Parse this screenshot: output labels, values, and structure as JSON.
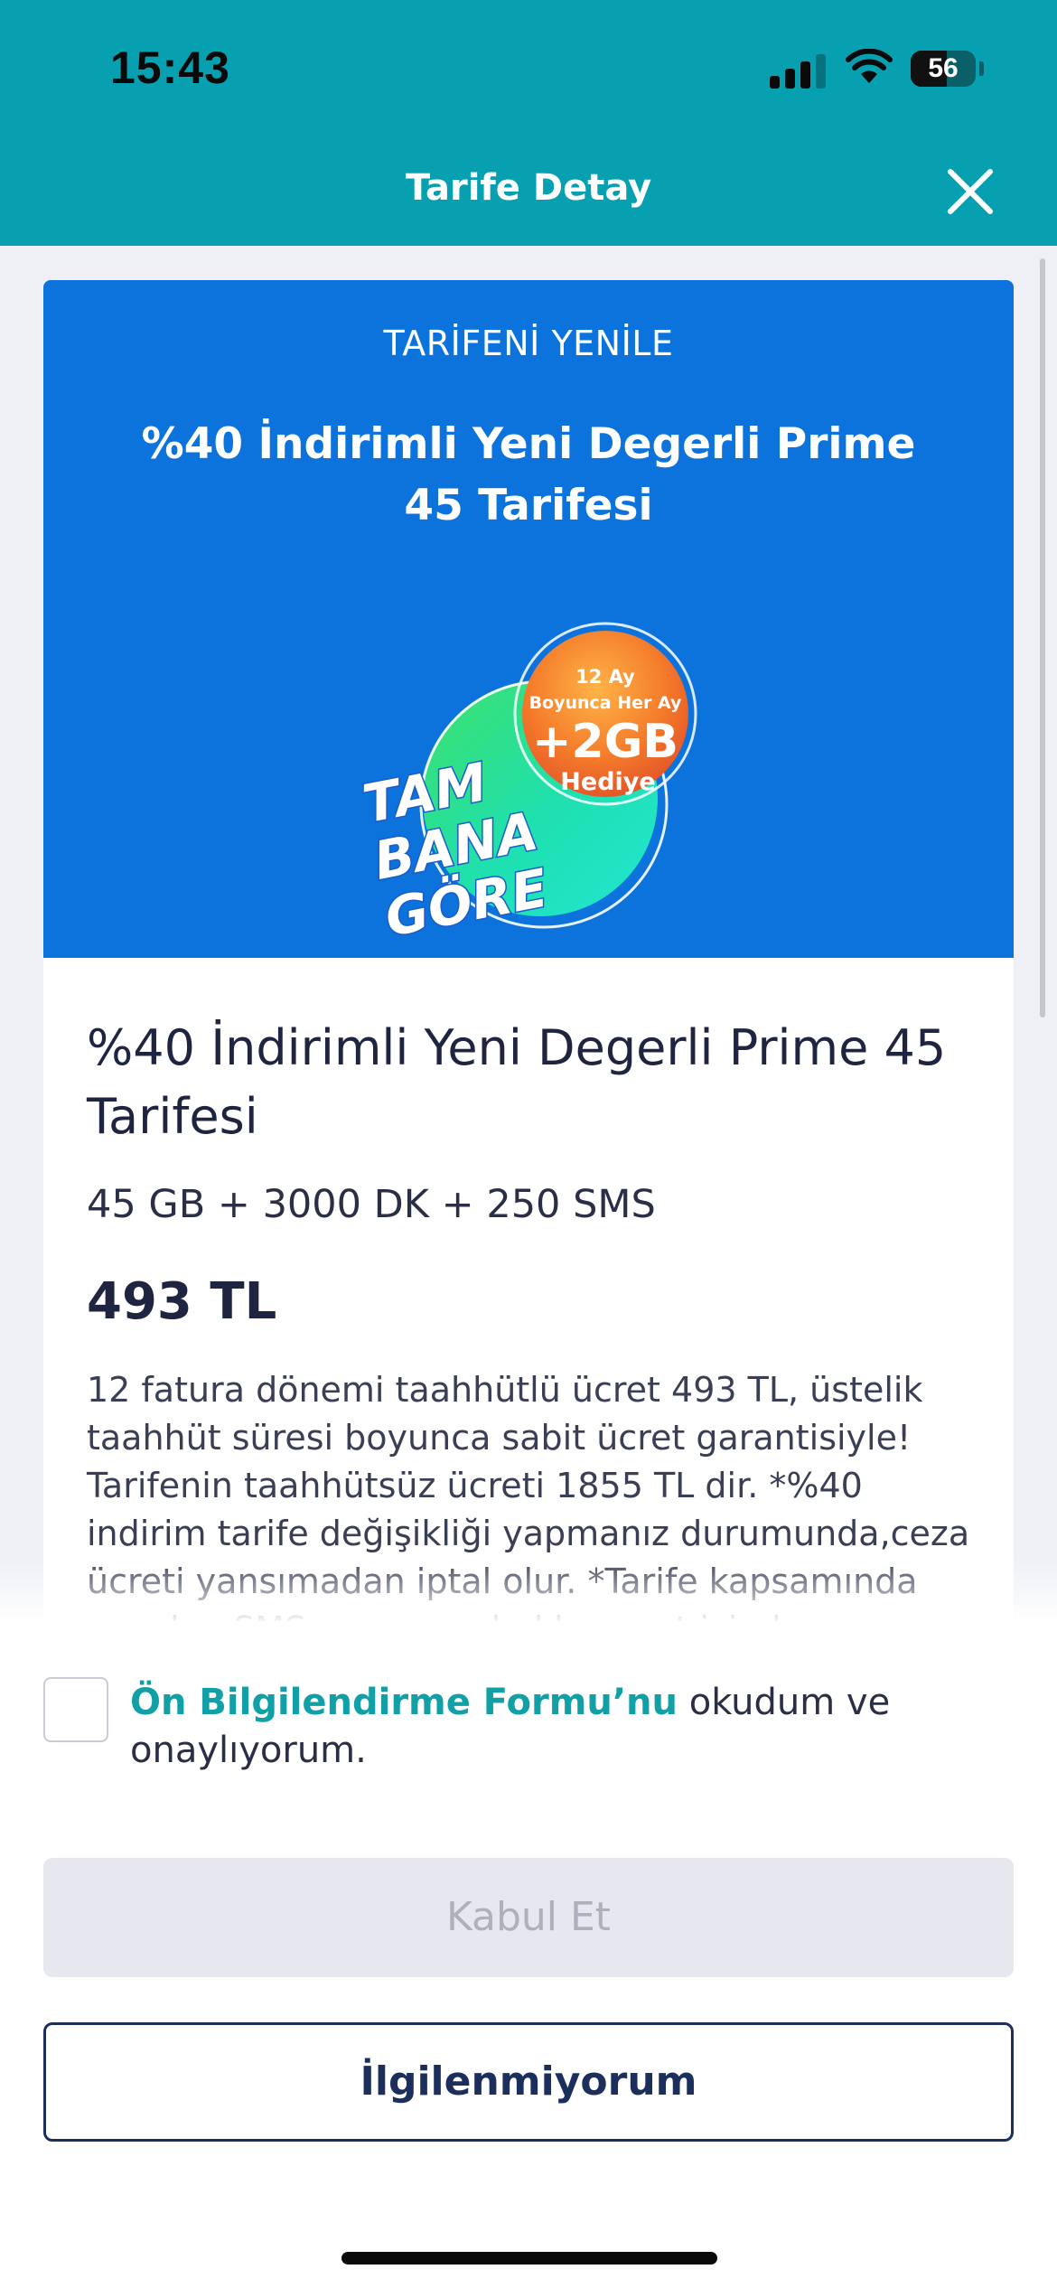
{
  "status_bar": {
    "time": "15:43",
    "battery_percent": "56",
    "battery_level": 0.56,
    "signal_bars_active": 3,
    "signal_bars_total": 4
  },
  "header": {
    "title": "Tarife Detay",
    "close_icon": "close-icon"
  },
  "promo": {
    "overline": "TARİFENİ YENİLE",
    "title": "%40 İndirimli Yeni Degerli Prime 45 Tarifesi",
    "badge": {
      "line1": "12 Ay",
      "line2": "Boyunca Her Ay",
      "line3": "+2GB",
      "line4": "Hediye"
    },
    "brand_lines": [
      "TAM",
      "BANA",
      "GÖRE"
    ]
  },
  "detail": {
    "title": "%40 İndirimli Yeni Degerli Prime 45 Tarifesi",
    "features": "45 GB + 3000 DK + 250 SMS",
    "price": "493 TL",
    "description": "12 fatura dönemi taahhütlü ücret 493 TL, üstelik taahhüt süresi boyunca sabit ücret garantisiyle! Tarifenin taahhütsüz ücreti 1855 TL dir. *%40 indirim tarife değişikliği yapmanız durumunda,ceza ücreti yansımadan iptal olur. *Tarife kapsamında sunulan SMS ve arama hakları yurt içinde geçerlidir."
  },
  "consent": {
    "link_text": "Ön Bilgilendirme Formu’nu",
    "rest_text": " okudum ve onaylıyorum.",
    "checked": false
  },
  "actions": {
    "accept_label": "Kabul Et",
    "decline_label": "İlgilenmiyorum"
  },
  "colors": {
    "header_bg": "#07A0B0",
    "promo_bg": "#0C73DC",
    "link": "#10A0A6",
    "navy": "#1C2F5C",
    "disabled_bg": "#E6E7EF"
  }
}
